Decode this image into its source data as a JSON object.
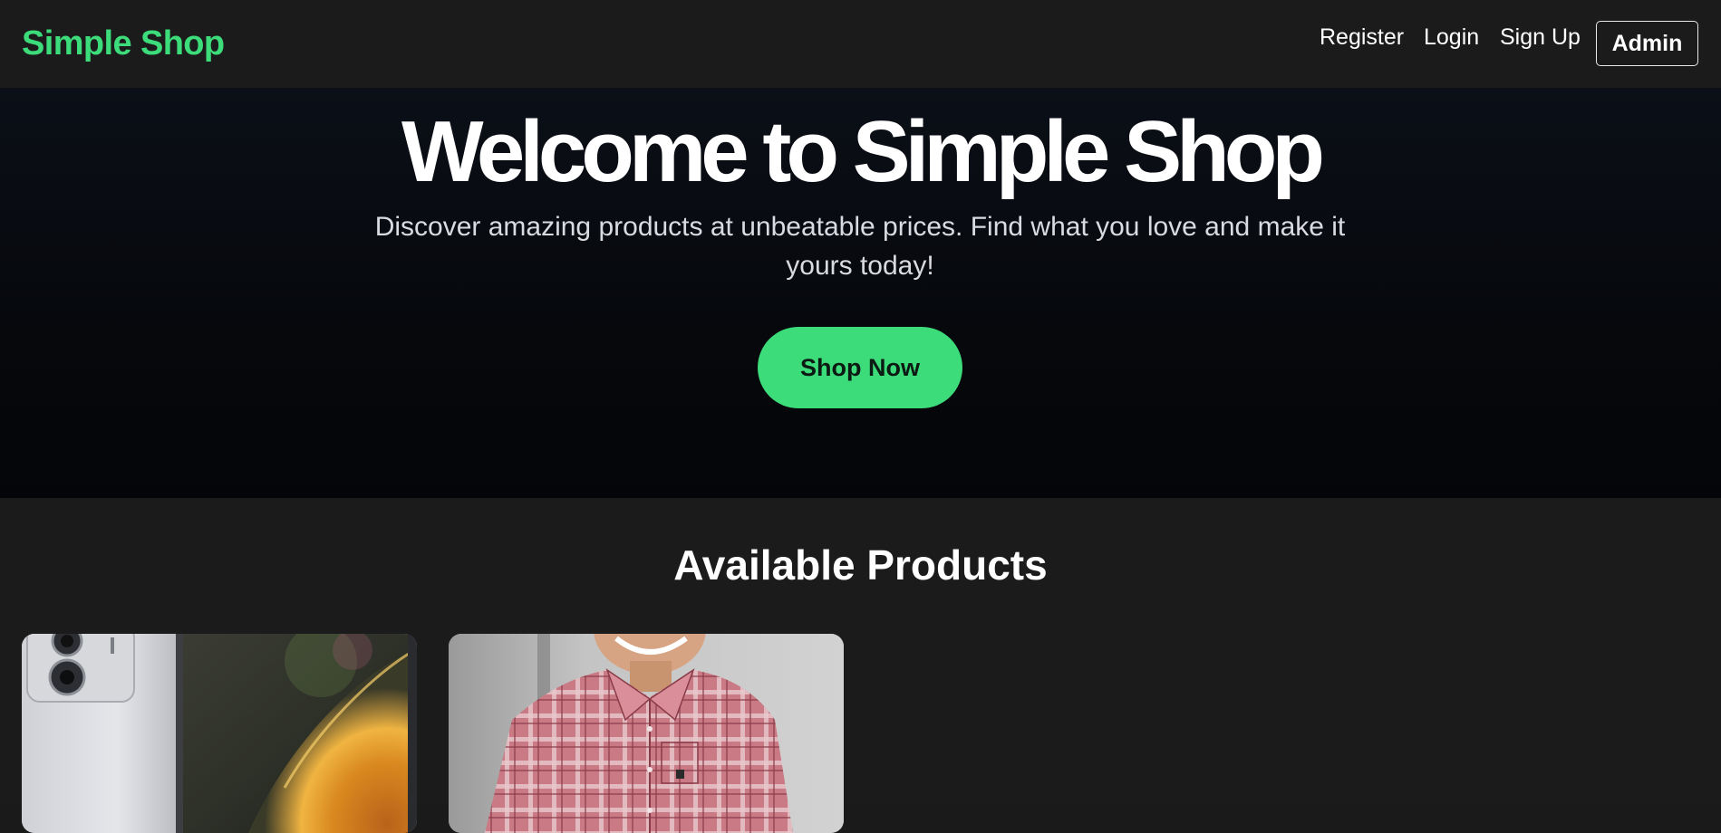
{
  "header": {
    "brand": "Simple Shop",
    "nav": {
      "register": "Register",
      "login": "Login",
      "signup": "Sign Up",
      "admin": "Admin"
    }
  },
  "hero": {
    "title": "Welcome to Simple Shop",
    "subtitle": "Discover amazing products at unbeatable prices. Find what you love and make it yours today!",
    "cta_label": "Shop Now"
  },
  "products": {
    "heading": "Available Products",
    "items": [
      {
        "image": "smartphone-product-photo"
      },
      {
        "image": "plaid-shirt-product-photo"
      }
    ]
  },
  "colors": {
    "accent": "#3ddc7b",
    "header_bg": "#1b1b1b",
    "hero_bg": "#06080c",
    "text": "#ffffff"
  }
}
